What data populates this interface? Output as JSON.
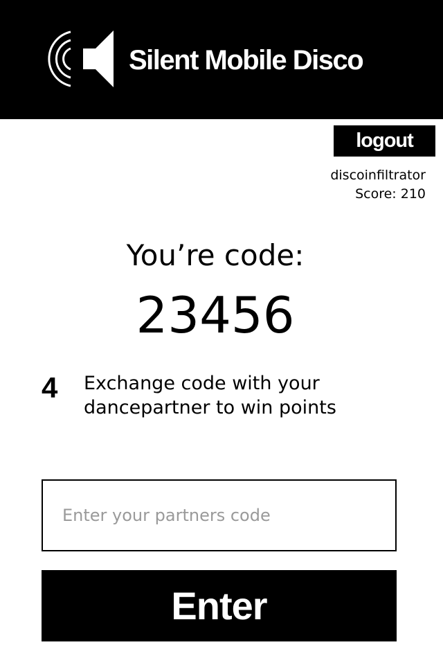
{
  "header": {
    "title": "Silent Mobile Disco",
    "logo_icon": "speaker-sound-waves-icon",
    "background": "#000000",
    "text_color": "#ffffff"
  },
  "account": {
    "logout_label": "logout",
    "username": "discoinfiltrator",
    "score_text": "Score: 210"
  },
  "code": {
    "label": "You’re code:",
    "value": "23456"
  },
  "step": {
    "number": "4",
    "instruction": "Exchange code with your dancepartner to win points"
  },
  "partner_input": {
    "value": "",
    "placeholder": "Enter your partners code"
  },
  "enter_button": {
    "label": "Enter"
  }
}
